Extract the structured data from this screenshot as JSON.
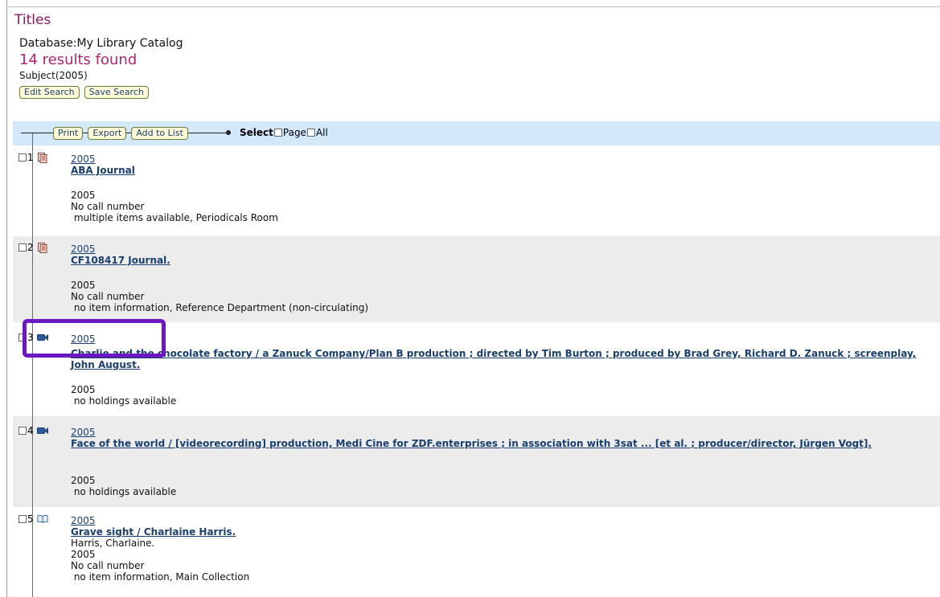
{
  "page": {
    "title": "Titles",
    "database_label": "Database:",
    "database_name": "My Library Catalog",
    "results_text": "14 results found",
    "subject_text": "Subject(2005)"
  },
  "actions": {
    "edit_search": "Edit Search",
    "save_search": "Save Search"
  },
  "toolbar": {
    "print": "Print",
    "export": "Export",
    "add_to_list": "Add to List",
    "select_label": "Select",
    "page_label": "Page",
    "all_label": "All"
  },
  "results": [
    {
      "index": "1",
      "material_icon": "periodical-icon",
      "year": "2005",
      "title": "ABA Journal",
      "lines": [
        "2005",
        "No call number",
        " multiple items available, Periodicals Room"
      ]
    },
    {
      "index": "2",
      "material_icon": "periodical-icon",
      "year": "2005",
      "title": "CF108417 Journal.",
      "lines": [
        "2005",
        "No call number",
        " no item information, Reference Department (non-circulating)"
      ]
    },
    {
      "index": "3",
      "material_icon": "video-camera-icon",
      "year": "2005",
      "title": "Charlie and the chocolate factory / a Zanuck Company/Plan B production ; directed by Tim Burton ; produced by Brad Grey, Richard D. Zanuck ; screenplay, John August.",
      "lines": [
        "2005",
        " no holdings available"
      ]
    },
    {
      "index": "4",
      "material_icon": "video-camera-icon",
      "year": "2005",
      "title": "Face of the world / [videorecording] production, Medi Cine for ZDF.enterprises ; in association with 3sat ... [et al. ; producer/director, Jürgen Vogt].",
      "lines": [
        "2005",
        " no holdings available"
      ]
    },
    {
      "index": "5",
      "material_icon": "book-icon",
      "year": "2005",
      "title": "Grave sight / Charlaine Harris.",
      "lines": [
        "Harris, Charlaine.",
        "2005",
        "No call number",
        " no item information, Main Collection"
      ]
    }
  ],
  "colors": {
    "title": "#8b1a5f",
    "results_count": "#b0246e",
    "link": "#1a3f6e",
    "toolbar_bg": "#d3e8fb",
    "row_shade": "#ececec",
    "highlight": "#6c18c2",
    "button_bg": "#fffbd8"
  }
}
